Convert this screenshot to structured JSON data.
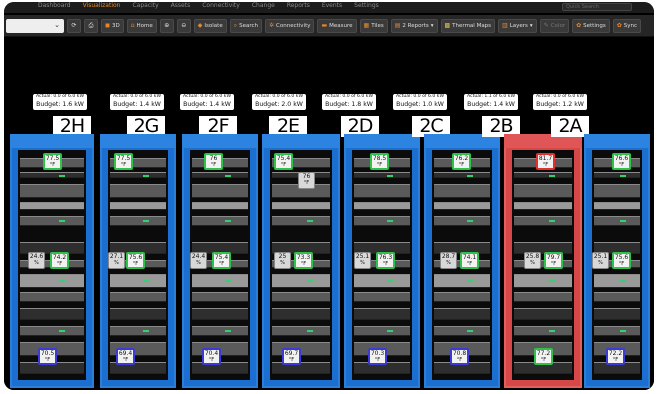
{
  "nav": {
    "items": [
      "Dashboard",
      "Visualization",
      "Capacity",
      "Assets",
      "Connectivity",
      "Change",
      "Reports",
      "Events",
      "Settings"
    ],
    "active_index": 1,
    "search_placeholder": "Quick Search"
  },
  "toolbar": {
    "dropdown_value": "",
    "buttons": {
      "refresh_icon": "refresh-icon",
      "print_icon": "print-icon",
      "btn_3d": "3D",
      "home": "Home",
      "isolate": "Isolate",
      "search": "Search",
      "connectivity": "Connectivity",
      "measure": "Measure",
      "tiles": "Tiles",
      "reports": "2 Reports",
      "thermal_maps": "Thermal Maps",
      "layers": "Layers",
      "color": "Color",
      "settings": "Settings",
      "sync": "Sync"
    }
  },
  "racks": [
    {
      "name": "2H",
      "actual": "Actual: 0.0 of 6.0 kW",
      "budget": "Budget: 1.6 kW",
      "top": {
        "v": "77.5",
        "u": "°F"
      },
      "hum": {
        "v": "24.6",
        "u": "%"
      },
      "mid": {
        "v": "74.2",
        "u": "°F"
      },
      "bot": {
        "v": "70.5",
        "u": "°F"
      },
      "hot": false
    },
    {
      "name": "2G",
      "actual": "Actual: 0.0 of 6.0 kW",
      "budget": "Budget: 1.4 kW",
      "top": {
        "v": "77.5",
        "u": "°F"
      },
      "hum": {
        "v": "27.1",
        "u": "%"
      },
      "mid": {
        "v": "75.6",
        "u": "°F"
      },
      "bot": {
        "v": "69.4",
        "u": "°F"
      },
      "hot": false
    },
    {
      "name": "2F",
      "actual": "Actual: 0.0 of 6.0 kW",
      "budget": "Budget: 1.4 kW",
      "top": {
        "v": "76",
        "u": "°F"
      },
      "hum": {
        "v": "24.4",
        "u": "%"
      },
      "mid": {
        "v": "75.4",
        "u": "°F"
      },
      "bot": {
        "v": "70.4",
        "u": "°F"
      },
      "hot": false
    },
    {
      "name": "2E",
      "actual": "Actual: 0.0 of 6.0 kW",
      "budget": "Budget: 2.0 kW",
      "top": {
        "v": "75.4",
        "u": "°F"
      },
      "hum": {
        "v": "25",
        "u": "%"
      },
      "mid": {
        "v": "73.3",
        "u": "°F"
      },
      "bot": {
        "v": "69.7",
        "u": "°F"
      },
      "hot": false,
      "extra": {
        "v": "76",
        "u": "°F"
      }
    },
    {
      "name": "2D",
      "actual": "Actual: 0.0 of 6.0 kW",
      "budget": "Budget: 1.8 kW",
      "top": {
        "v": "78.5",
        "u": "°F"
      },
      "hum": {
        "v": "25.1",
        "u": "%"
      },
      "mid": {
        "v": "76.3",
        "u": "°F"
      },
      "bot": {
        "v": "70.3",
        "u": "°F"
      },
      "hot": false
    },
    {
      "name": "2C",
      "actual": "Actual: 0.0 of 6.0 kW",
      "budget": "Budget: 1.0 kW",
      "top": {
        "v": "76.2",
        "u": "°F"
      },
      "hum": {
        "v": "28.7",
        "u": "%"
      },
      "mid": {
        "v": "74.1",
        "u": "°F"
      },
      "bot": {
        "v": "70.8",
        "u": "°F"
      },
      "hot": false
    },
    {
      "name": "2B",
      "actual": "Actual: 1.1 of 6.0 kW",
      "budget": "Budget: 1.4 kW",
      "top": {
        "v": "81.7",
        "u": "°F"
      },
      "hum": {
        "v": "25.8",
        "u": "%"
      },
      "mid": {
        "v": "79.7",
        "u": "°F"
      },
      "bot": {
        "v": "77.2",
        "u": "°F"
      },
      "hot": true
    },
    {
      "name": "2A",
      "actual": "Actual: 0.0 of 6.0 kW",
      "budget": "Budget: 1.2 kW",
      "top": {
        "v": "76.6",
        "u": "°F"
      },
      "hum": {
        "v": "25.1",
        "u": "%"
      },
      "mid": {
        "v": "75.6",
        "u": "°F"
      },
      "bot": {
        "v": "72.2",
        "u": "°F"
      },
      "hot": false
    }
  ],
  "colors": {
    "accent": "#e5872f",
    "rack_blue": "#1a6fd0",
    "rack_hot": "#d64848",
    "temp_ok": "#2ec24a",
    "temp_cold": "#3a3ad6",
    "temp_hot": "#e03030"
  }
}
